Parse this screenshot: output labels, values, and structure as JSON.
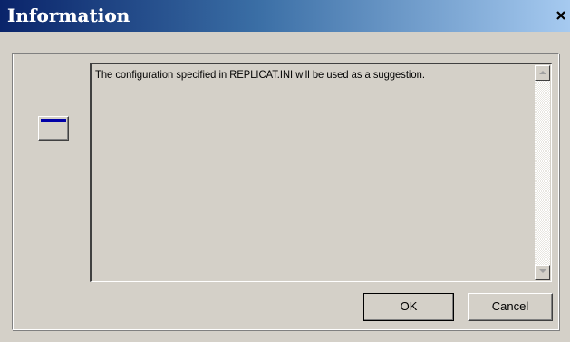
{
  "window": {
    "title": "Information",
    "close_label": "✕"
  },
  "icon": "window-icon",
  "message": "The configuration specified in REPLICAT.INI will be used as a suggestion.",
  "buttons": {
    "ok": "OK",
    "cancel": "Cancel"
  },
  "colors": {
    "titlebar_start": "#0a246a",
    "titlebar_end": "#a6caf0",
    "face": "#d4d0c8"
  }
}
